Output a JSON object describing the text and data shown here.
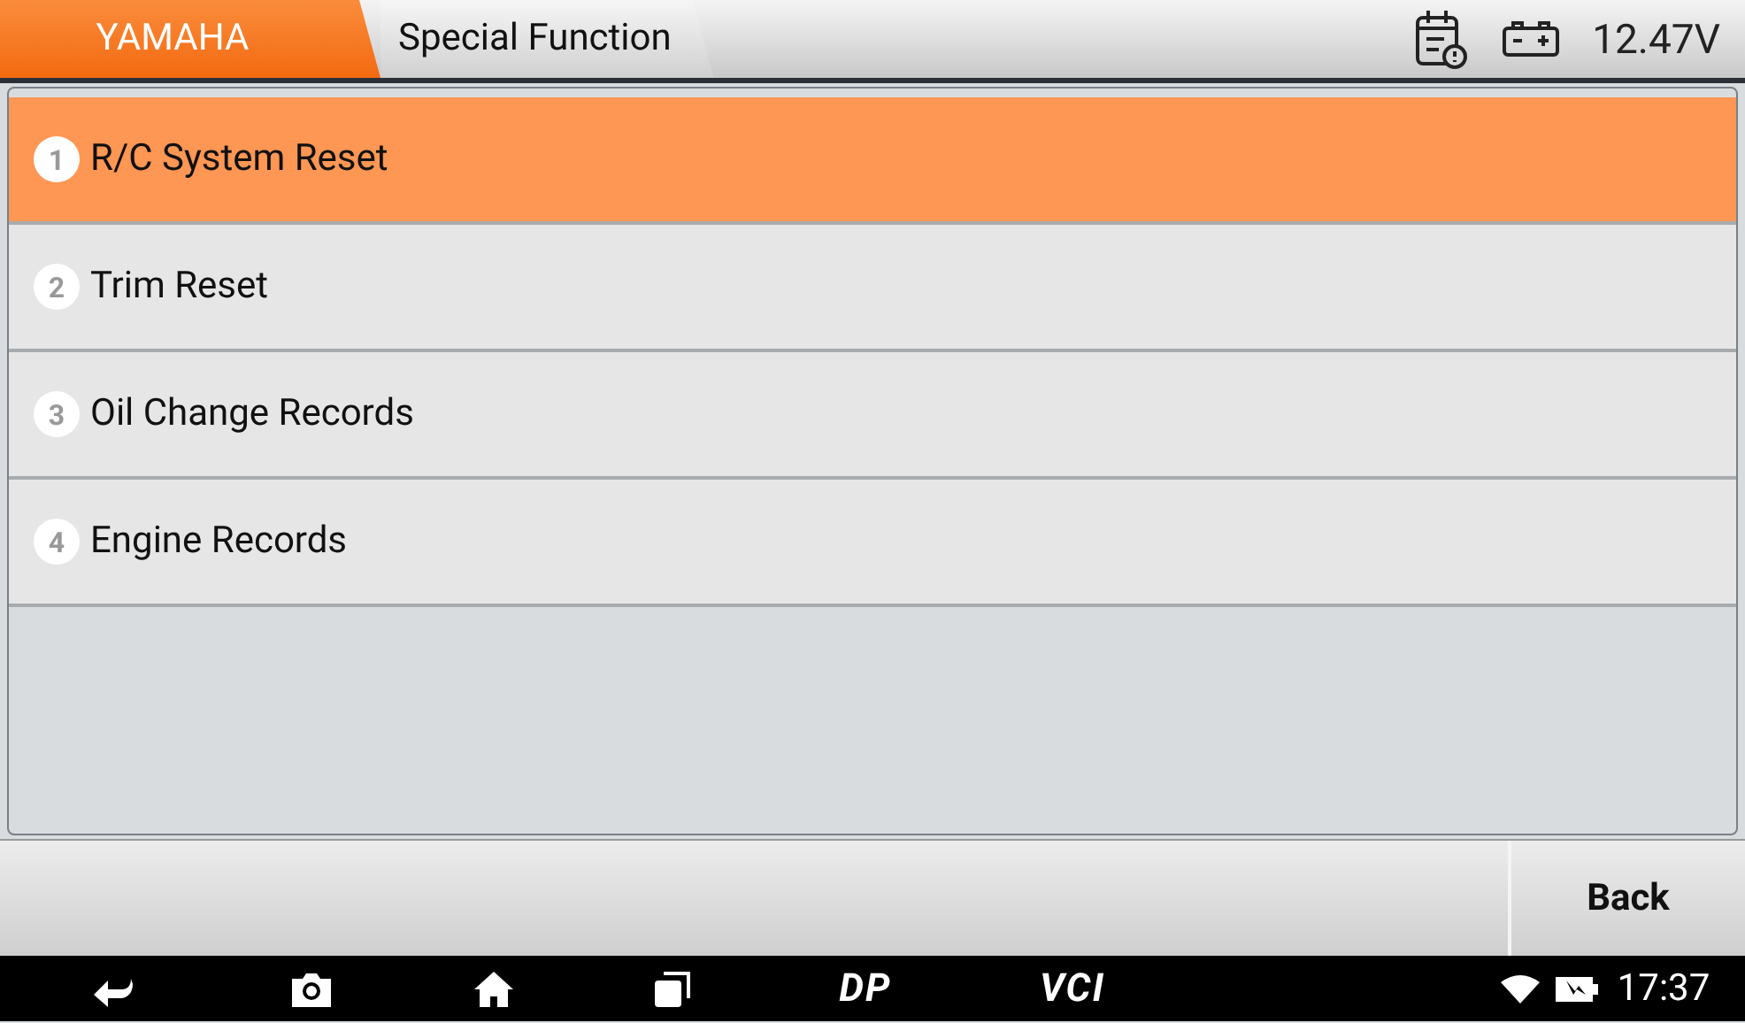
{
  "breadcrumb": [
    {
      "label": "YAMAHA",
      "selected": true
    },
    {
      "label": "Special Function",
      "selected": false
    }
  ],
  "status": {
    "voltage": "12.47V"
  },
  "menu": [
    {
      "number": "1",
      "label": "R/C System Reset",
      "selected": true
    },
    {
      "number": "2",
      "label": "Trim Reset",
      "selected": false
    },
    {
      "number": "3",
      "label": "Oil Change Records",
      "selected": false
    },
    {
      "number": "4",
      "label": "Engine Records",
      "selected": false
    }
  ],
  "buttons": [
    "Back"
  ],
  "nav_bar": {
    "dp": "DP",
    "vci": "VCI",
    "time": "17:37"
  }
}
